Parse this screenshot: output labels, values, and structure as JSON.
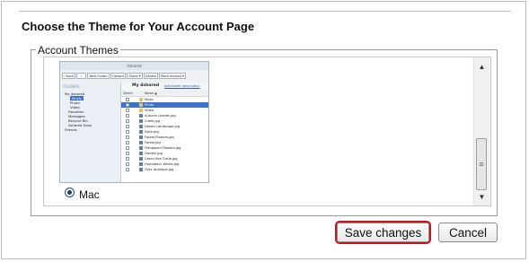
{
  "page": {
    "title": "Choose the Theme for Your Account Page"
  },
  "themes_section": {
    "legend": "Account Themes"
  },
  "theme_option": {
    "name": "Mac",
    "selected": true,
    "preview": {
      "window_title": "4shared",
      "toolbar": [
        "‹ Back",
        "›",
        "New Folder",
        "Upload",
        "Share ▾",
        "Delete",
        "More actions ▾"
      ],
      "sidebar_header": "FOLDERS",
      "sidebar_items": [
        "My 4shared",
        "Music",
        "Photo",
        "Video",
        "Favorites",
        "Messages",
        "Recycle Bin",
        "4shared Tools",
        "Friends"
      ],
      "selected_sidebar_item": "Music",
      "path_title": "My 4shared",
      "path_link": "Add folder description",
      "columns": [
        "Select",
        "Name ▲"
      ],
      "files": [
        {
          "name": "Music",
          "type": "folder"
        },
        {
          "name": "Photo",
          "type": "folder",
          "selected": true
        },
        {
          "name": "Video",
          "type": "folder"
        },
        {
          "name": "Autumn Leaves.jpg",
          "type": "file"
        },
        {
          "name": "Creek.jpg",
          "type": "file"
        },
        {
          "name": "Desert Landscape.jpg",
          "type": "file"
        },
        {
          "name": "Dock.jpg",
          "type": "file"
        },
        {
          "name": "Forest Flowers.jpg",
          "type": "file"
        },
        {
          "name": "Forest.jpg",
          "type": "file"
        },
        {
          "name": "Frangipani Flowers.jpg",
          "type": "file"
        },
        {
          "name": "Garden.jpg",
          "type": "file"
        },
        {
          "name": "Green Sea Turtle.jpg",
          "type": "file"
        },
        {
          "name": "Humpback Whale.jpg",
          "type": "file"
        },
        {
          "name": "Oryx Antelope.jpg",
          "type": "file"
        }
      ]
    }
  },
  "actions": {
    "save_label": "Save changes",
    "cancel_label": "Cancel"
  },
  "icons": {
    "scroll_up": "up-arrow-icon",
    "scroll_down": "down-arrow-icon",
    "scroll_grip": "grip-icon"
  },
  "colors": {
    "save_focus_border": "#c8141a",
    "selection_blue": "#3d72c8"
  }
}
